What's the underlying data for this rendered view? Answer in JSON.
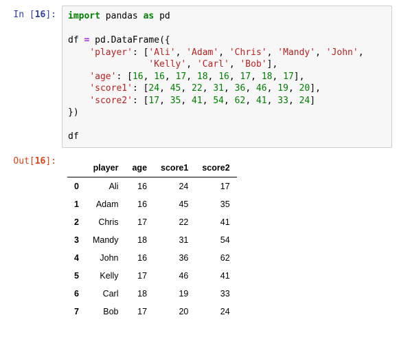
{
  "input": {
    "prompt_prefix": "In [",
    "prompt_number": "16",
    "prompt_suffix": "]:",
    "code": {
      "kw_import": "import",
      "mod": "pandas",
      "kw_as": "as",
      "alias": "pd",
      "assign_lhs": "df",
      "eq": "=",
      "call": "pd.DataFrame",
      "open_brace": "({",
      "key_player": "'player'",
      "player_vals": [
        "'Ali'",
        "'Adam'",
        "'Chris'",
        "'Mandy'",
        "'John'",
        "'Kelly'",
        "'Carl'",
        "'Bob'"
      ],
      "key_age": "'age'",
      "age_vals": [
        "16",
        "16",
        "17",
        "18",
        "16",
        "17",
        "18",
        "17"
      ],
      "key_score1": "'score1'",
      "score1_vals": [
        "24",
        "45",
        "22",
        "31",
        "36",
        "46",
        "19",
        "20"
      ],
      "key_score2": "'score2'",
      "score2_vals": [
        "17",
        "35",
        "41",
        "54",
        "62",
        "41",
        "33",
        "24"
      ],
      "close_brace": "})",
      "expr": "df"
    }
  },
  "output": {
    "prompt_prefix": "Out[",
    "prompt_number": "16",
    "prompt_suffix": "]:",
    "columns": [
      "player",
      "age",
      "score1",
      "score2"
    ],
    "index": [
      "0",
      "1",
      "2",
      "3",
      "4",
      "5",
      "6",
      "7"
    ],
    "rows": [
      [
        "Ali",
        "16",
        "24",
        "17"
      ],
      [
        "Adam",
        "16",
        "45",
        "35"
      ],
      [
        "Chris",
        "17",
        "22",
        "41"
      ],
      [
        "Mandy",
        "18",
        "31",
        "54"
      ],
      [
        "John",
        "16",
        "36",
        "62"
      ],
      [
        "Kelly",
        "17",
        "46",
        "41"
      ],
      [
        "Carl",
        "18",
        "19",
        "33"
      ],
      [
        "Bob",
        "17",
        "20",
        "24"
      ]
    ]
  },
  "chart_data": {
    "type": "table",
    "title": "DataFrame",
    "columns": [
      "player",
      "age",
      "score1",
      "score2"
    ],
    "index": [
      0,
      1,
      2,
      3,
      4,
      5,
      6,
      7
    ],
    "rows": [
      {
        "player": "Ali",
        "age": 16,
        "score1": 24,
        "score2": 17
      },
      {
        "player": "Adam",
        "age": 16,
        "score1": 45,
        "score2": 35
      },
      {
        "player": "Chris",
        "age": 17,
        "score1": 22,
        "score2": 41
      },
      {
        "player": "Mandy",
        "age": 18,
        "score1": 31,
        "score2": 54
      },
      {
        "player": "John",
        "age": 16,
        "score1": 36,
        "score2": 62
      },
      {
        "player": "Kelly",
        "age": 17,
        "score1": 46,
        "score2": 41
      },
      {
        "player": "Carl",
        "age": 18,
        "score1": 19,
        "score2": 33
      },
      {
        "player": "Bob",
        "age": 17,
        "score1": 20,
        "score2": 24
      }
    ]
  }
}
